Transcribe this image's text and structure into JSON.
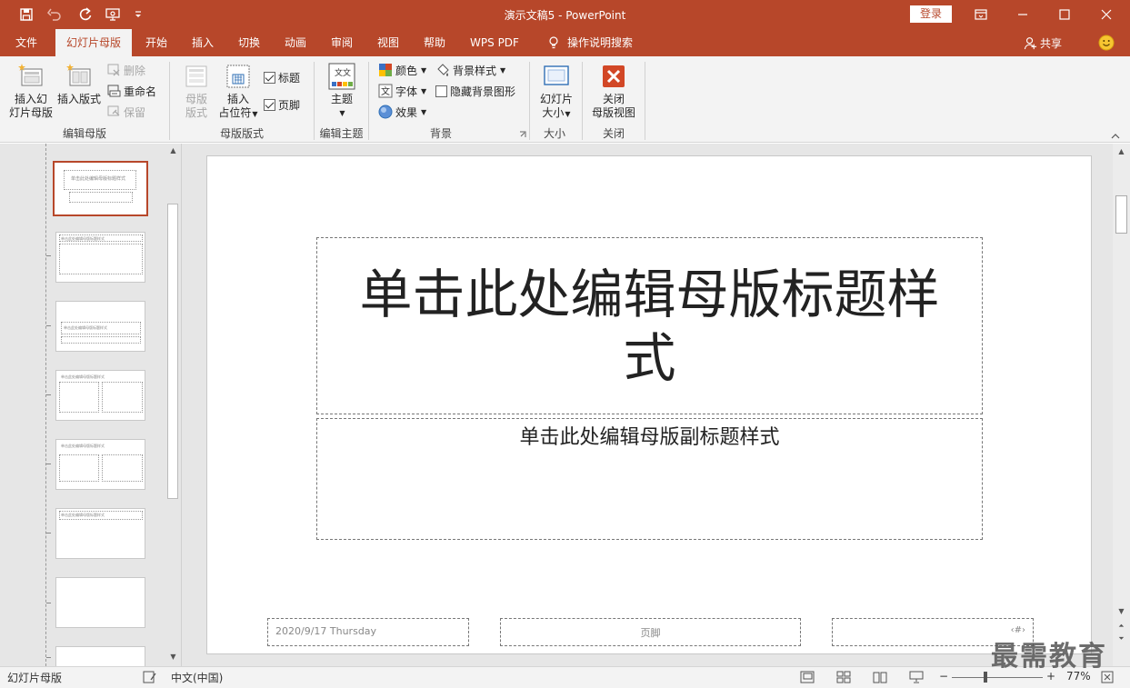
{
  "window": {
    "title": "演示文稿5  -  PowerPoint",
    "login": "登录"
  },
  "tabs": [
    {
      "label": "文件"
    },
    {
      "label": "幻灯片母版",
      "active": true
    },
    {
      "label": "开始"
    },
    {
      "label": "插入"
    },
    {
      "label": "切换"
    },
    {
      "label": "动画"
    },
    {
      "label": "审阅"
    },
    {
      "label": "视图"
    },
    {
      "label": "帮助"
    },
    {
      "label": "WPS PDF"
    },
    {
      "label": "操作说明搜索"
    }
  ],
  "share_label": "共享",
  "ribbon": {
    "edit_master": {
      "label": "编辑母版",
      "insert_master_line1": "插入幻",
      "insert_master_line2": "灯片母版",
      "insert_layout": "插入版式",
      "delete": "删除",
      "rename": "重命名",
      "preserve": "保留"
    },
    "master_layout": {
      "label": "母版版式",
      "master_layout_line1": "母版",
      "master_layout_line2": "版式",
      "insert_ph_line1": "插入",
      "insert_ph_line2": "占位符",
      "title_chk": "标题",
      "footer_chk": "页脚"
    },
    "edit_theme": {
      "label": "编辑主题",
      "theme": "主题"
    },
    "background": {
      "label": "背景",
      "colors": "颜色",
      "fonts": "字体",
      "effects": "效果",
      "bg_styles": "背景样式",
      "hide_bg": "隐藏背景图形"
    },
    "size": {
      "label": "大小",
      "slide_size_line1": "幻灯片",
      "slide_size_line2": "大小"
    },
    "close": {
      "label": "关闭",
      "close_line1": "关闭",
      "close_line2": "母版视图"
    }
  },
  "slide": {
    "title": "单击此处编辑母版标题样式",
    "subtitle": "单击此处编辑母版副标题样式",
    "date": "2020/9/17 Thursday",
    "footer": "页脚",
    "number": "‹#›"
  },
  "thumbnails": [
    {
      "text": "单击此处编辑母版标题样式"
    },
    {
      "text": "单击此处编辑母版标题样式"
    },
    {
      "text": "单击此处编辑母版标题样式"
    },
    {
      "text": "单击此处编辑母版标题样式"
    },
    {
      "text": "单击此处编辑母版标题样式"
    },
    {
      "text": "单击此处编辑母版标题样式"
    }
  ],
  "status": {
    "view": "幻灯片母版",
    "language": "中文(中国)",
    "zoom": "77%"
  },
  "watermark": "最需教育",
  "colors": {
    "accent": "#b7472a"
  }
}
